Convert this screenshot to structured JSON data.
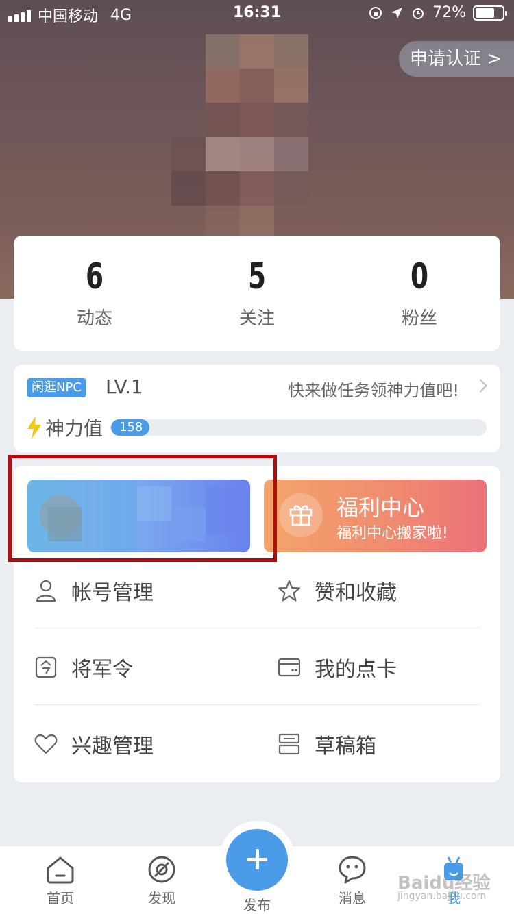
{
  "status_bar": {
    "carrier": "中国移动",
    "network": "4G",
    "time": "16:31",
    "battery": "72%",
    "battery_level": 0.72
  },
  "header": {
    "certify_label": "申请认证 >"
  },
  "stats": [
    {
      "value": "6",
      "label": "动态"
    },
    {
      "value": "5",
      "label": "关注"
    },
    {
      "value": "0",
      "label": "粉丝"
    }
  ],
  "level": {
    "badge": "闲逛NPC",
    "lv": "LV.1",
    "task_text": "快来做任务领神力值吧!",
    "power_label": "神力值",
    "power_value": "158"
  },
  "welfare": {
    "title": "福利中心",
    "subtitle": "福利中心搬家啦!"
  },
  "menu": {
    "items": [
      {
        "label": "帐号管理",
        "icon": "user-icon"
      },
      {
        "label": "赞和收藏",
        "icon": "star-icon"
      },
      {
        "label": "将军令",
        "icon": "token-icon"
      },
      {
        "label": "我的点卡",
        "icon": "card-icon"
      },
      {
        "label": "兴趣管理",
        "icon": "heart-icon"
      },
      {
        "label": "草稿箱",
        "icon": "drafts-icon"
      }
    ]
  },
  "tabbar": {
    "tabs": [
      {
        "label": "首页",
        "icon": "home-icon"
      },
      {
        "label": "发现",
        "icon": "compass-icon"
      },
      {
        "label": "发布",
        "icon": "plus-icon"
      },
      {
        "label": "消息",
        "icon": "chat-icon"
      },
      {
        "label": "我",
        "icon": "me-icon"
      }
    ]
  },
  "watermark": {
    "text": "Baidu经验",
    "sub": "jingyan.baidu.com"
  },
  "colors": {
    "accent": "#4a9be8",
    "highlight": "#b40b10",
    "welfare_start": "#f4a46a",
    "welfare_end": "#ec707a"
  }
}
